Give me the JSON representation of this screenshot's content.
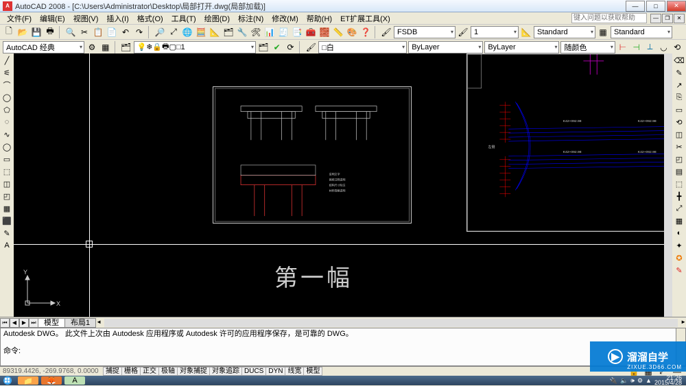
{
  "window": {
    "app_icon_letter": "A",
    "title": "AutoCAD 2008 - [C:\\Users\\Administrator\\Desktop\\局部打开.dwg(局部加载)]"
  },
  "win_controls": {
    "min": "—",
    "max": "□",
    "close": "✕"
  },
  "doc_controls": {
    "min": "—",
    "restore": "❐",
    "close": "✕"
  },
  "menubar": {
    "items": [
      "文件(F)",
      "编辑(E)",
      "视图(V)",
      "插入(I)",
      "格式(O)",
      "工具(T)",
      "绘图(D)",
      "标注(N)",
      "修改(M)",
      "帮助(H)",
      "ET扩展工具(X)"
    ],
    "help_placeholder": "键入问题以获取帮助"
  },
  "toolbar_std": {
    "icons": [
      "🗋",
      "📂",
      "💾",
      "🖶",
      "🔍",
      "✂",
      "📋",
      "📄",
      "↶",
      "↷",
      "🔎",
      "⤢",
      "🌐",
      "🧮",
      "📐",
      "🗂",
      "🔧",
      "🛠",
      "📊",
      "🧾",
      "📑",
      "🧰",
      "🧱",
      "📏",
      "🎨",
      "❓"
    ]
  },
  "properties_bar": {
    "font_name": "FSDB",
    "lineweight": "1",
    "textstyle1": "Standard",
    "textstyle2": "Standard"
  },
  "layers_bar": {
    "workspace": "AutoCAD 经典",
    "layer_state_icons": [
      "💡",
      "❄",
      "🔒",
      "🖶",
      "▢"
    ],
    "layer_name": "□1",
    "color_control": "□白",
    "linetype": "ByLayer",
    "lineweight": "ByLayer",
    "plotstyle": "随颜色"
  },
  "left_tools": [
    "╱",
    "⚟",
    "⌒",
    "◯",
    "⬠",
    "◌",
    "∿",
    "◯",
    "▭",
    "⬚",
    "◫",
    "◰",
    "▦",
    "⬛",
    "✎",
    "A"
  ],
  "right_tools": [
    "⌫",
    "✎",
    "↗",
    "⎘",
    "▭",
    "⟲",
    "◫",
    "✂",
    "◰",
    "▤",
    "⬚",
    "╋",
    "⤢",
    "▦",
    "◐",
    "✦",
    "✪",
    "✎"
  ],
  "canvas": {
    "ucs_x": "X",
    "ucs_y": "Y",
    "main_text": "第一幅",
    "frame2_labels": [
      "K42+092.98",
      "K42+092.98",
      "K42+092.98",
      "K42+092.98"
    ],
    "frame2_side": "左侧"
  },
  "tabs": {
    "nav": [
      "⏮",
      "◀",
      "▶",
      "⏭"
    ],
    "items": [
      "模型",
      "布局1"
    ]
  },
  "command": {
    "line1": "Autodesk DWG。  此文件上次由 Autodesk 应用程序或 Autodesk 许可的应用程序保存，是可靠的 DWG。",
    "prompt": "命令:",
    "input": ""
  },
  "status": {
    "coords": "89319.4426, -269.9768, 0.0000",
    "toggles": [
      "捕捉",
      "栅格",
      "正交",
      "极轴",
      "对象捕捉",
      "对象追踪",
      "DUCS",
      "DYN",
      "线宽",
      "模型"
    ]
  },
  "taskbar": {
    "clock": "21:26",
    "date": "2015/4/28",
    "tray_icons": [
      "🔌",
      "🔈",
      "🕪",
      "⚙",
      "▲"
    ]
  },
  "watermark": {
    "text": "溜溜自学",
    "sub": "ZIXUE.3D66.COM"
  }
}
